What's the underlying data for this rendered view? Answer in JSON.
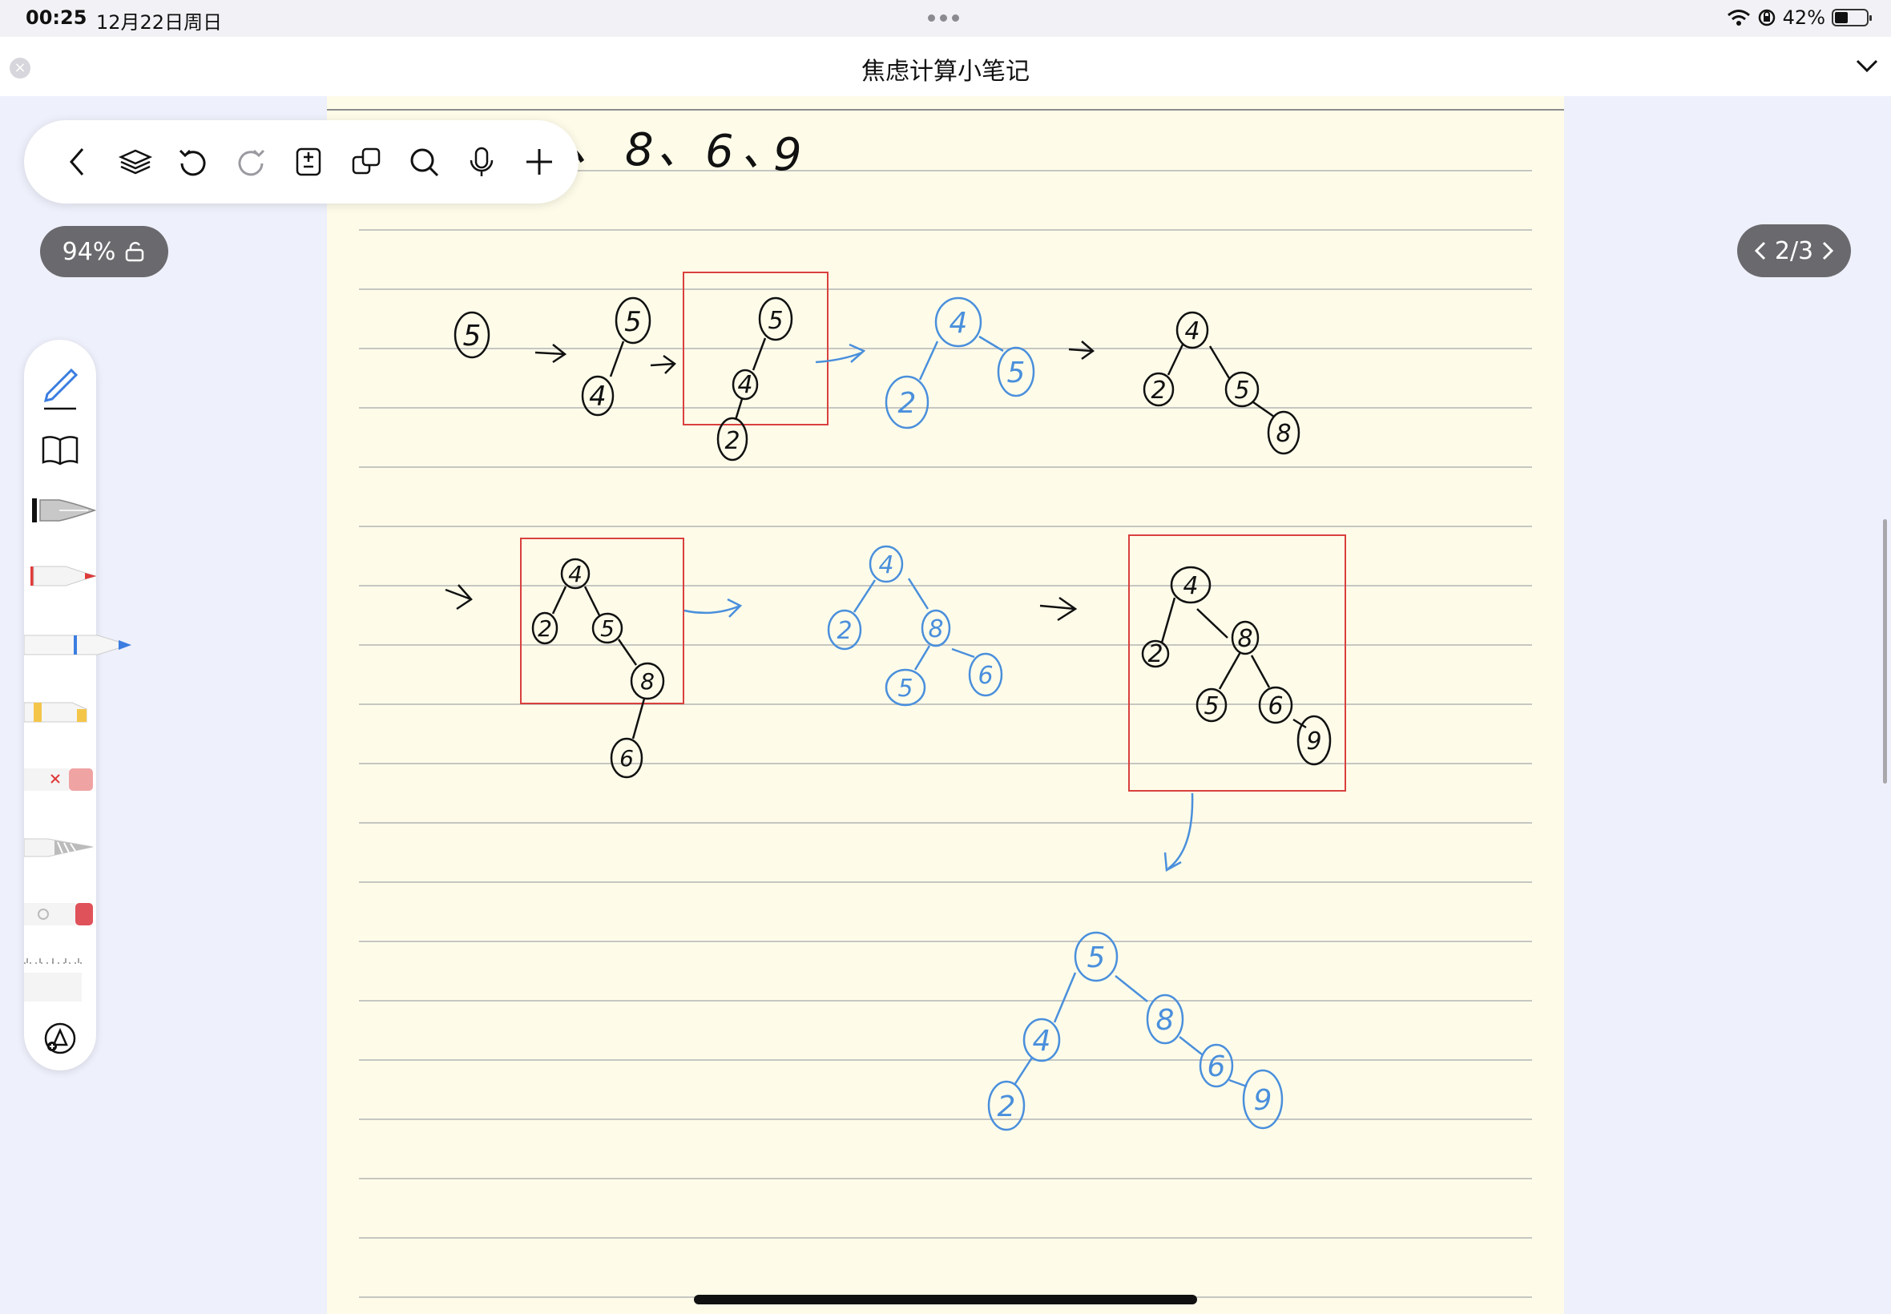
{
  "status_bar": {
    "time": "00:25",
    "date": "12月22日周日",
    "battery_percent": "42%",
    "icons": [
      "wifi-icon",
      "orientation-lock-icon",
      "battery-icon"
    ]
  },
  "title_bar": {
    "title": "焦虑计算小笔记"
  },
  "toolbar": {
    "items": [
      "back-icon",
      "layers-icon",
      "undo-icon",
      "redo-icon",
      "page-list-icon",
      "copy-icon",
      "search-icon",
      "mic-icon",
      "add-icon"
    ]
  },
  "zoom": {
    "label": "94%"
  },
  "pager": {
    "label": "2/3"
  },
  "tools": [
    "pen",
    "book",
    "fountain-pen",
    "red-pen",
    "blue-pen",
    "highlighter",
    "eraser",
    "lasso",
    "shape-tool",
    "ruler",
    "more-tools"
  ],
  "notes": {
    "header_chars": [
      "、",
      "8",
      "、",
      "6",
      "、",
      "9"
    ],
    "step1": {
      "nodes": [
        "5"
      ]
    },
    "step2": {
      "nodes": [
        "5",
        "4"
      ]
    },
    "step3": {
      "nodes": [
        "5",
        "4",
        "2"
      ]
    },
    "step4": {
      "nodes": [
        "4",
        "2",
        "5"
      ]
    },
    "step5": {
      "nodes": [
        "4",
        "2",
        "5",
        "8"
      ]
    },
    "step6": {
      "nodes": [
        "4",
        "2",
        "5",
        "8",
        "6"
      ]
    },
    "step7": {
      "nodes": [
        "4",
        "2",
        "8",
        "5",
        "6"
      ]
    },
    "step8": {
      "nodes": [
        "4",
        "2",
        "8",
        "5",
        "6",
        "9"
      ]
    },
    "final": {
      "nodes": [
        "5",
        "4",
        "8",
        "2",
        "6",
        "9"
      ]
    }
  },
  "colors": {
    "ink_black": "#111111",
    "ink_blue": "#4a8fdc",
    "box_red": "#d9403e",
    "paper": "#fefce9",
    "background": "#eef0fb"
  }
}
